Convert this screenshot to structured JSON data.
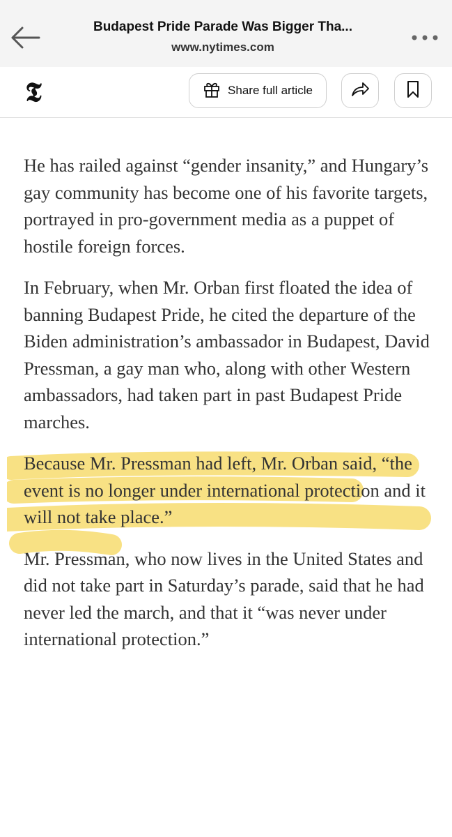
{
  "browser": {
    "title": "Budapest Pride Parade Was Bigger Tha...",
    "url": "www.nytimes.com",
    "back_icon": "back-arrow-icon",
    "more_icon": "more-dots-icon"
  },
  "site_bar": {
    "logo": "𝕿",
    "share_label": "Share full article",
    "share_icon": "gift-icon",
    "forward_icon": "share-arrow-icon",
    "bookmark_icon": "bookmark-icon"
  },
  "article": {
    "paragraphs": [
      "He has railed against “gender insanity,” and Hungary’s gay community has become one of his favorite targets, portrayed in pro-government media as a puppet of hostile foreign forces.",
      "In February, when Mr. Orban first floated the idea of banning Budapest Pride, he cited the departure of the Biden administration’s ambassador in Budapest, David Pressman, a gay man who, along with other Western ambassadors, had taken part in past Budapest Pride marches.",
      "Because Mr. Pressman had left, Mr. Orban said, “the event is no longer under international protection and it will not take place.”",
      "Mr. Pressman, who now lives in the United States and did not take part in Saturday’s parade, said that he had never led the march, and that it “was never under international protection.”"
    ],
    "highlight_color": "#f7dc6f"
  }
}
